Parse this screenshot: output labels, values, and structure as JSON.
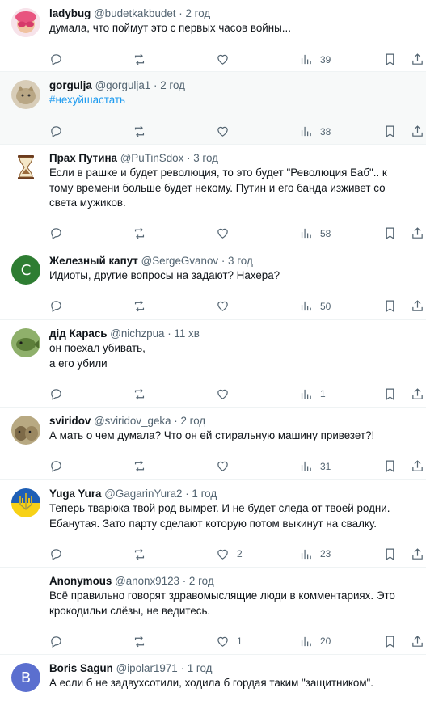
{
  "tweets": [
    {
      "name": "ladybug",
      "handle": "@budetkakbudet",
      "dot": "·",
      "time": "2 год",
      "text": [
        "думала, что поймут это с первых часов войны..."
      ],
      "likes": "",
      "views": "39",
      "avatar": {
        "icon": "ladybug-sunglasses-avatar",
        "color": "#e46a8c"
      }
    },
    {
      "name": "gorgulja",
      "handle": "@gorgulja1",
      "dot": "·",
      "time": "2 год",
      "text": [
        "#нехуйшастать"
      ],
      "likes": "",
      "views": "38",
      "avatar": {
        "icon": "cat-photo-avatar",
        "color": "#c9b79a"
      }
    },
    {
      "name": "Прах Путина",
      "handle": "@PuTinSdox",
      "dot": "·",
      "time": "3 год",
      "text": [
        "Если в рашке и будет революция, то это будет \"Революция  Баб\".. к",
        "тому времени больше будет некому. Путин и его банда изживет со",
        "света мужиков."
      ],
      "likes": "",
      "views": "58",
      "avatar": {
        "icon": "hourglass-avatar",
        "color": "#ffffff"
      }
    },
    {
      "name": "Железный капут",
      "handle": "@SergeGvanov",
      "dot": "·",
      "time": "3 год",
      "text": [
        "Идиоты, другие вопросы на задают? Нахера?"
      ],
      "likes": "",
      "views": "50",
      "avatar": {
        "icon": "letter-avatar",
        "letter": "C",
        "color": "#2e7d32"
      }
    },
    {
      "name": "дід Карась",
      "handle": "@nichzpua",
      "dot": "·",
      "time": "11 хв",
      "text": [
        "он поехал убивать,",
        "а его убили"
      ],
      "likes": "",
      "views": "1",
      "avatar": {
        "icon": "fish-photo-avatar",
        "color": "#6b8f4e"
      }
    },
    {
      "name": "sviridov",
      "handle": "@sviridov_geka",
      "dot": "·",
      "time": "2 год",
      "text": [
        "А мать о чем думала? Что он ей стиральную машину привезет?!"
      ],
      "likes": "",
      "views": "31",
      "avatar": {
        "icon": "cats-photo-avatar",
        "color": "#8a7a5a"
      }
    },
    {
      "name": "Yuga Yura",
      "handle": "@GagarinYura2",
      "dot": "·",
      "time": "1 год",
      "text": [
        "Теперь тварюка твой род вымрет. И не будет следа от твоей родни.",
        "Ебанутая. Зато парту сделают которую потом выкинут на свалку."
      ],
      "likes": "2",
      "views": "23",
      "avatar": {
        "icon": "trident-avatar",
        "color": "#1f5fb5"
      }
    },
    {
      "name": "Anonymous",
      "handle": "@anonx9123",
      "dot": "·",
      "time": "2 год",
      "text": [
        "Всё правильно говорят здравомыслящие люди в комментариях. Это",
        "крокодильи слёзы, не ведитесь."
      ],
      "likes": "1",
      "views": "20",
      "avatar": {
        "icon": "anonymous-mask-avatar",
        "color": "#ffffff"
      }
    },
    {
      "name": "Boris Sagun",
      "handle": "@ipolar1971",
      "dot": "·",
      "time": "1 год",
      "text": [
        "А если б не задвухсотили, ходила б гордая таким \"защитником\"."
      ],
      "likes": "",
      "views": "",
      "avatar": {
        "icon": "letter-avatar",
        "letter": "B",
        "color": "#5b6fcf"
      }
    }
  ]
}
